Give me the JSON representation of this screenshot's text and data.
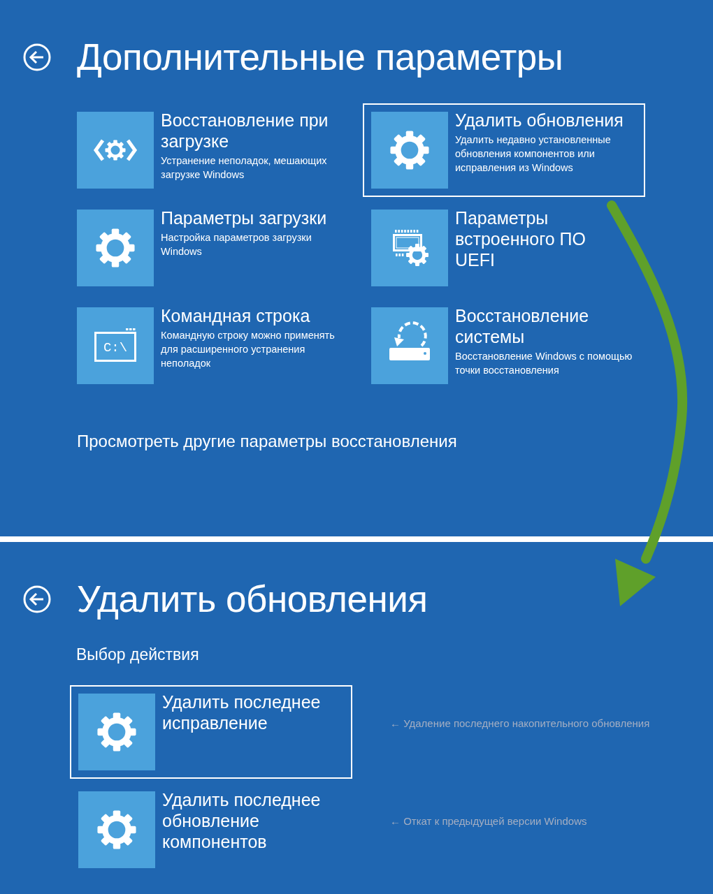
{
  "screens": [
    {
      "title": "Дополнительные параметры",
      "options": [
        {
          "kind": "repair",
          "title": "Восстановление при загрузке",
          "description": "Устранение неполадок, мешающих загрузке Windows",
          "selected": false
        },
        {
          "kind": "settings",
          "title": "Удалить обновления",
          "description": "Удалить недавно установленные обновления компонентов или исправления из Windows",
          "selected": true
        },
        {
          "kind": "settings",
          "title": "Параметры загрузки",
          "description": "Настройка параметров загрузки Windows",
          "selected": false
        },
        {
          "kind": "firmware",
          "title": "Параметры встроенного ПО UEFI",
          "selected": false
        },
        {
          "kind": "console",
          "title": "Командная строка",
          "description": "Командную строку можно применять для расширенного устранения неполадок",
          "icon_text": "C:\\",
          "selected": false
        },
        {
          "kind": "restore",
          "title": "Восстановление системы",
          "description": "Восстановление Windows с помощью точки восстановления",
          "selected": false
        }
      ],
      "link": "Просмотреть другие параметры восстановления"
    },
    {
      "title": "Удалить обновления",
      "subtitle": "Выбор действия",
      "options": [
        {
          "kind": "settings",
          "title": "Удалить последнее исправление",
          "selected": true,
          "note": "← Удаление последнего накопительного обновления"
        },
        {
          "kind": "settings",
          "title": "Удалить последнее обновление компонентов",
          "selected": false,
          "note": "← Откат к предыдущей версии Windows"
        }
      ]
    }
  ]
}
